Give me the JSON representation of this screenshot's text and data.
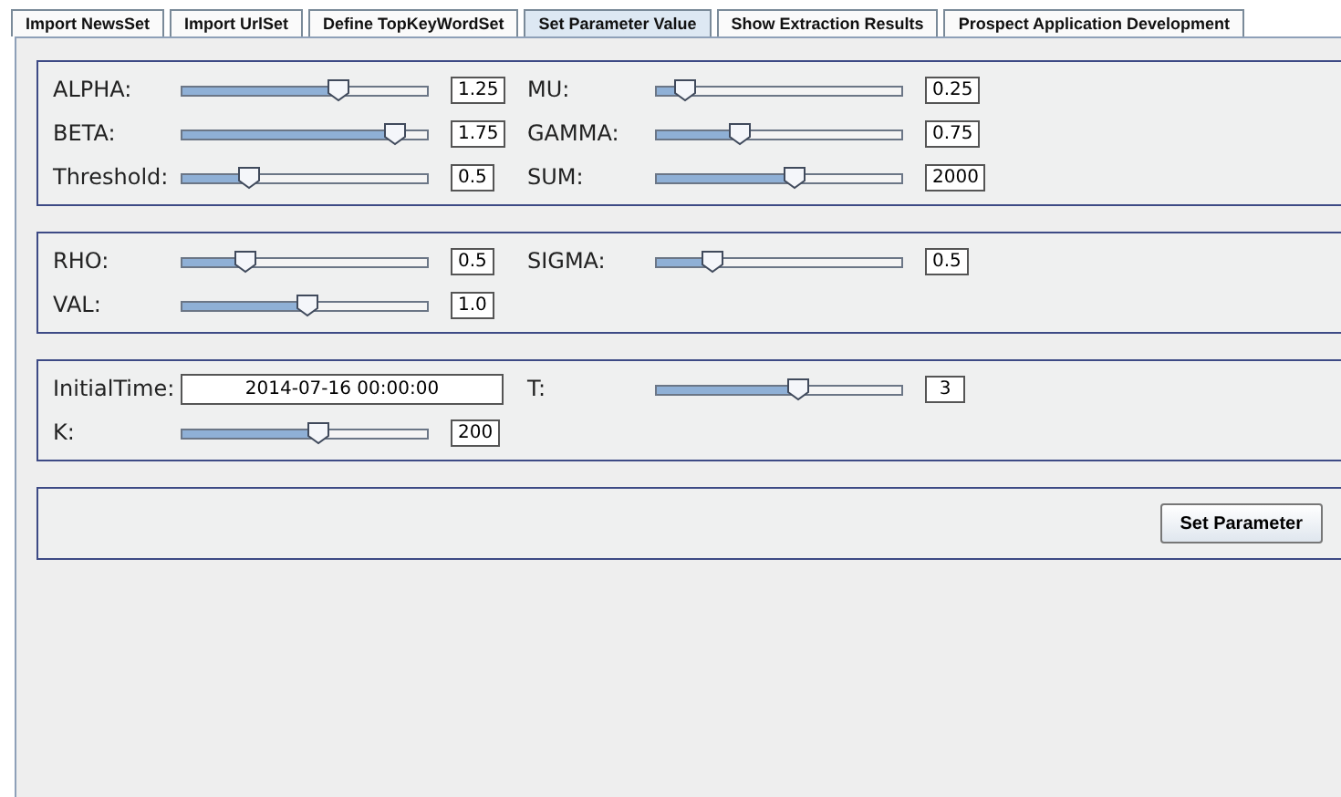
{
  "tabs": [
    {
      "label": "Import NewsSet",
      "selected": false
    },
    {
      "label": "Import UrlSet",
      "selected": false
    },
    {
      "label": "Define TopKeyWordSet",
      "selected": false
    },
    {
      "label": "Set Parameter Value",
      "selected": true
    },
    {
      "label": "Show Extraction Results",
      "selected": false
    },
    {
      "label": "Prospect Application Development",
      "selected": false
    }
  ],
  "panels": [
    {
      "rows": [
        [
          {
            "kind": "slider",
            "label": "ALPHA:",
            "level": 0.63,
            "value": "1.25"
          },
          {
            "kind": "slider",
            "label": "MU:",
            "level": 0.12,
            "value": "0.25"
          }
        ],
        [
          {
            "kind": "slider",
            "label": "BETA:",
            "level": 0.86,
            "value": "1.75"
          },
          {
            "kind": "slider",
            "label": "GAMMA:",
            "level": 0.34,
            "value": "0.75"
          }
        ],
        [
          {
            "kind": "slider",
            "label": "Threshold:",
            "level": 0.27,
            "value": "0.5"
          },
          {
            "kind": "slider",
            "label": "SUM:",
            "level": 0.56,
            "value": "2000"
          }
        ]
      ]
    },
    {
      "rows": [
        [
          {
            "kind": "slider",
            "label": "RHO:",
            "level": 0.26,
            "value": "0.5"
          },
          {
            "kind": "slider",
            "label": "SIGMA:",
            "level": 0.23,
            "value": "0.5"
          }
        ],
        [
          {
            "kind": "slider",
            "label": "VAL:",
            "level": 0.51,
            "value": "1.0"
          }
        ]
      ]
    },
    {
      "rows": [
        [
          {
            "kind": "text",
            "label": "InitialTime:",
            "value": "2014-07-16 00:00:00"
          },
          {
            "kind": "slider",
            "label": "T:",
            "level": 0.57,
            "value": "3"
          }
        ],
        [
          {
            "kind": "slider",
            "label": "K:",
            "level": 0.55,
            "value": "200"
          }
        ]
      ]
    }
  ],
  "button": "Set Parameter"
}
